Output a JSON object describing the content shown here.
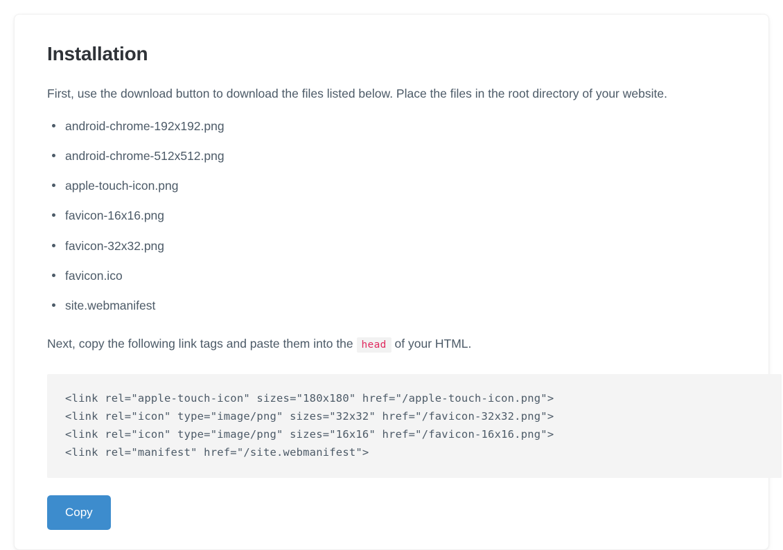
{
  "card": {
    "heading": "Installation",
    "intro_paragraph": "First, use the download button to download the files listed below. Place the files in the root directory of your website.",
    "file_list": [
      "android-chrome-192x192.png",
      "android-chrome-512x512.png",
      "apple-touch-icon.png",
      "favicon-16x16.png",
      "favicon-32x32.png",
      "favicon.ico",
      "site.webmanifest"
    ],
    "next_paragraph": {
      "before_code": "Next, copy the following link tags and paste them into the",
      "code": "head",
      "after_code": "of your HTML."
    },
    "code_block": {
      "lines": [
        "<link rel=\"apple-touch-icon\" sizes=\"180x180\" href=\"/apple-touch-icon.png\">",
        "<link rel=\"icon\" type=\"image/png\" sizes=\"32x32\" href=\"/favicon-32x32.png\">",
        "<link rel=\"icon\" type=\"image/png\" sizes=\"16x16\" href=\"/favicon-16x16.png\">",
        "<link rel=\"manifest\" href=\"/site.webmanifest\">"
      ]
    },
    "copy_button_label": "Copy"
  },
  "colors": {
    "page_background": "#ffffff",
    "card_background": "#ffffff",
    "heading_text": "#2f3338",
    "body_text": "#4c5a67",
    "inline_code_text": "#e0295e",
    "inline_code_background": "#f2f2f2",
    "code_block_background": "#f4f4f4",
    "code_block_text": "#4c5a67",
    "copy_button_background": "#3d8ccd",
    "copy_button_text": "#ffffff"
  }
}
